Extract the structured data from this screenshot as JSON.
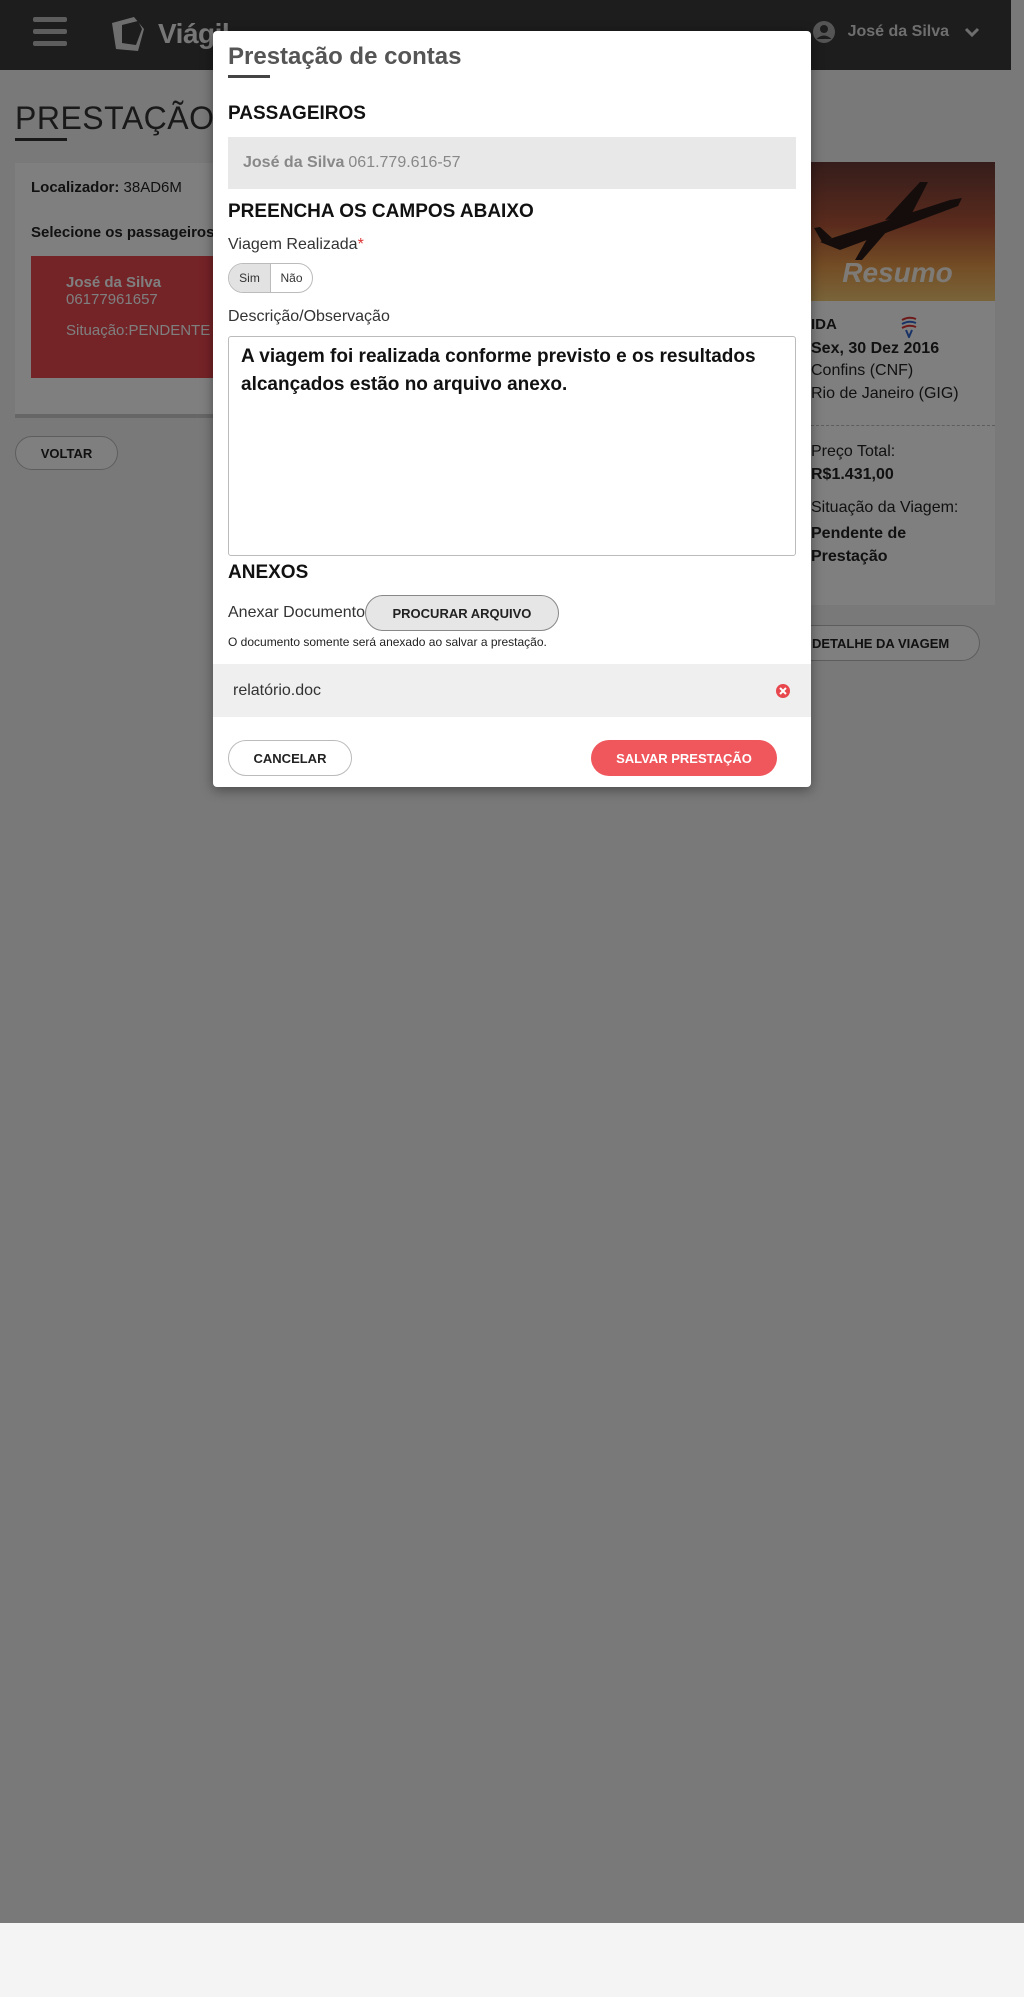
{
  "header": {
    "brand": "Viágil",
    "user_name": "José da Silva"
  },
  "page": {
    "title": "PRESTAÇÃO D",
    "locator_label": "Localizador:",
    "locator_value": "38AD6M",
    "select_text": "Selecione os passageiros p",
    "passenger": {
      "name": "José da Silva",
      "document": "06177961657",
      "status": "Situação:PENDENTE"
    },
    "back_label": "VOLTAR"
  },
  "summary": {
    "image_label": "Resumo",
    "direction": "IDA",
    "date": "Sex, 30 Dez 2016",
    "from": "Confins (CNF)",
    "to": "Rio de Janeiro (GIG)",
    "price_label": "Preço Total:",
    "price_value": "R$1.431,00",
    "status_label": "Situação da Viagem:",
    "status_value": "Pendente de Prestação",
    "details_label": "DETALHE DA VIAGEM"
  },
  "modal": {
    "title": "Prestação de contas",
    "passengers_heading": "PASSAGEIROS",
    "passenger_name": "José da Silva",
    "passenger_cpf": "061.779.616-57",
    "fill_heading": "PREENCHA OS CAMPOS ABAIXO",
    "trip_done_label": "Viagem Realizada",
    "required_mark": "*",
    "toggle_yes": "Sim",
    "toggle_no": "Não",
    "description_label": "Descrição/Observação",
    "description_value": "A viagem foi realizada conforme previsto e os resultados alcançados estão no arquivo anexo.",
    "attachments_heading": "ANEXOS",
    "attach_label": "Anexar Documento",
    "browse_label": "PROCURAR ARQUIVO",
    "attach_note": "O documento somente será anexado ao salvar a prestação.",
    "file_name": "relatório.doc",
    "cancel_label": "CANCELAR",
    "save_label": "SALVAR PRESTAÇÃO"
  },
  "colors": {
    "accent": "#f0575d",
    "header_bg": "#3a3a3a",
    "passenger_card": "#e8474e"
  }
}
